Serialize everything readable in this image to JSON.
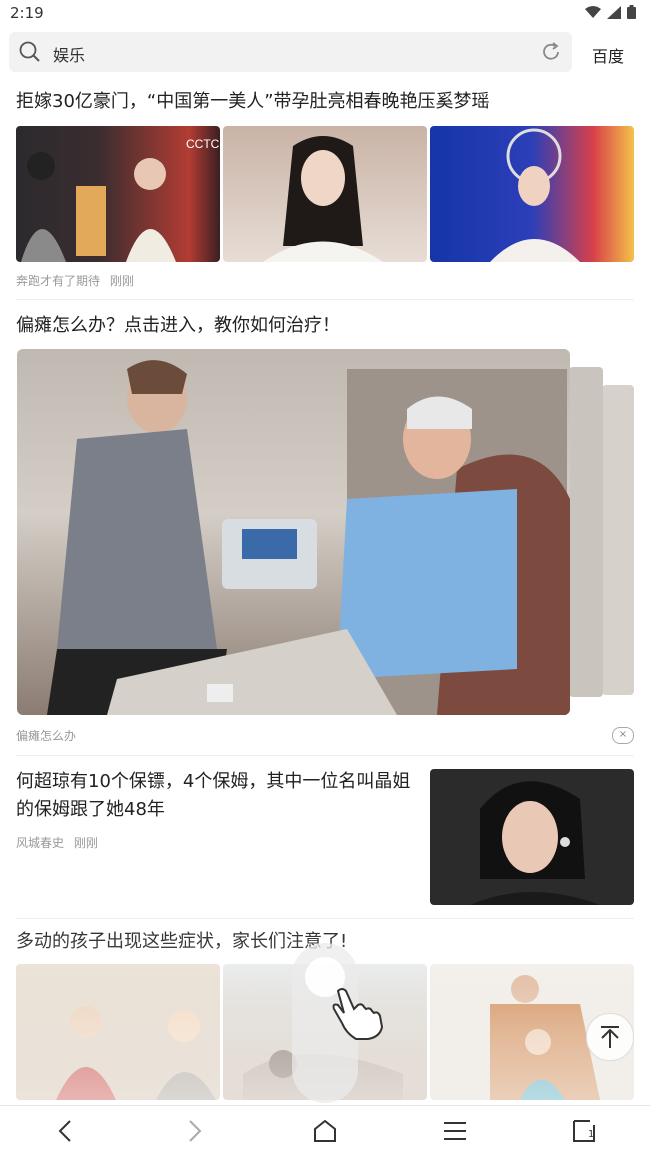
{
  "status": {
    "time": "2:19"
  },
  "search": {
    "query": "娱乐",
    "engine": "百度"
  },
  "feed": [
    {
      "title": "拒嫁30亿豪门，“中国第一美人”带孕肚亮相春晚艳压奚梦瑶",
      "source": "奔跑才有了期待",
      "time": "刚刚"
    },
    {
      "title": "偏瘫怎么办？点击进入，教你如何治疗！",
      "source": "偏瘫怎么办",
      "ad_close": "×"
    },
    {
      "title": "何超琼有10个保镖，4个保姆，其中一位名叫晶姐的保姆跟了她48年",
      "source": "风城春史",
      "time": "刚刚"
    },
    {
      "title": "多动的孩子出现这些症状，家长们注意了!"
    }
  ],
  "nav": {
    "tabs_count": "1"
  }
}
